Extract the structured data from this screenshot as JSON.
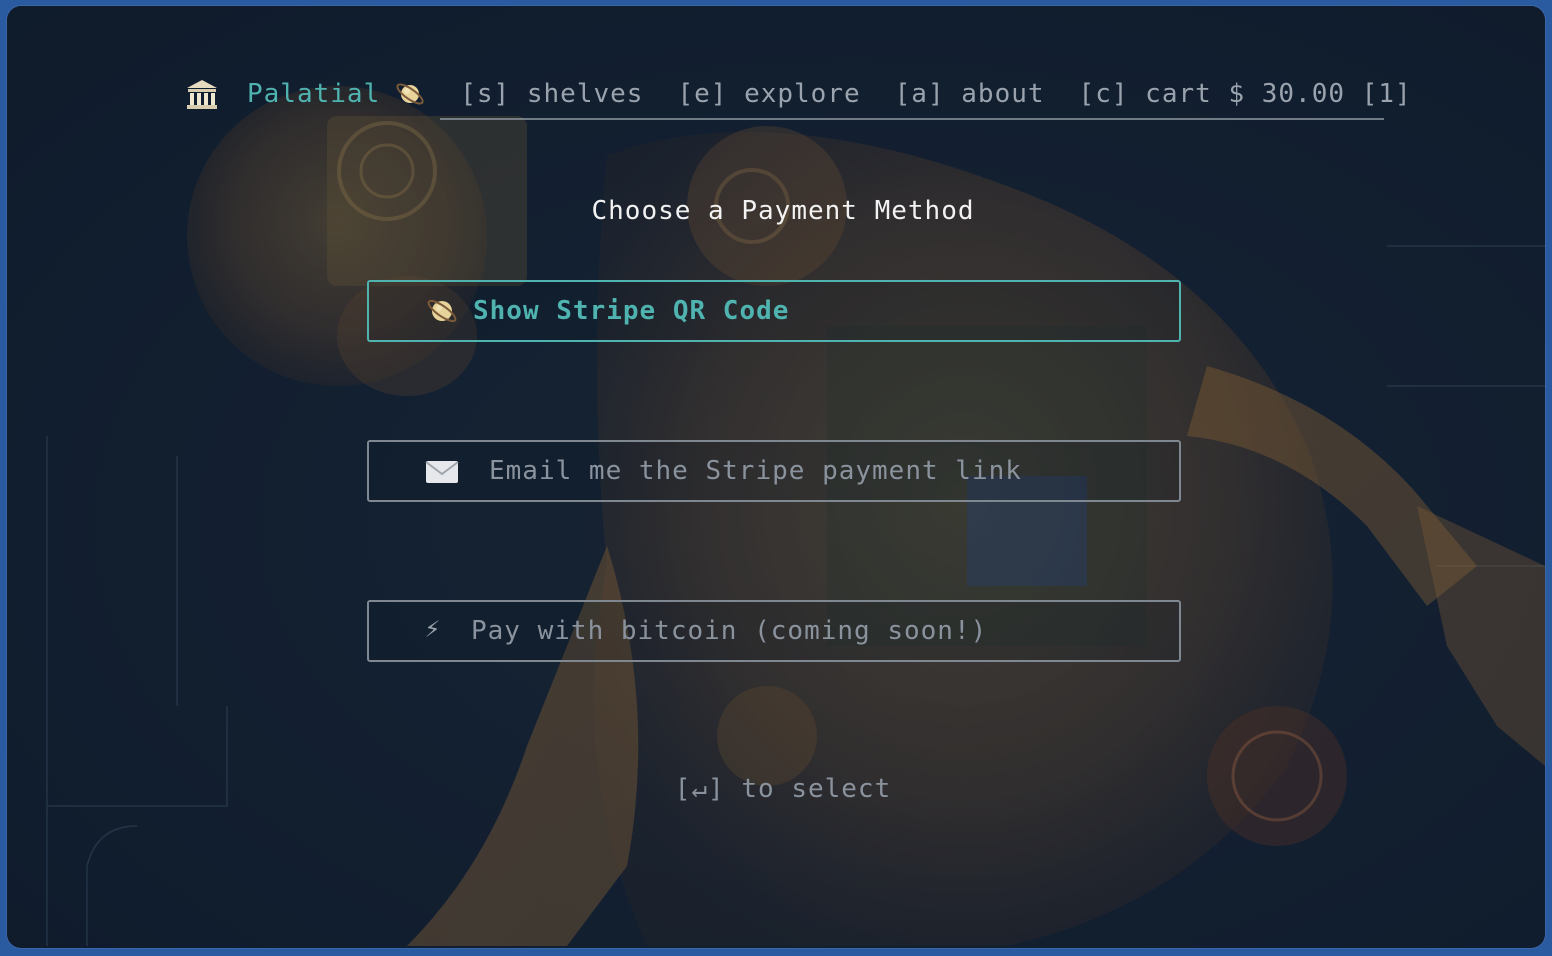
{
  "nav": {
    "brand": "Palatial",
    "logo_icon": "classical-building-icon",
    "brand_icon": "ringed-planet-icon",
    "items": [
      {
        "key": "[s]",
        "label": "shelves"
      },
      {
        "key": "[e]",
        "label": "explore"
      },
      {
        "key": "[a]",
        "label": "about"
      },
      {
        "key": "[c]",
        "label": "cart $ 30.00 [1]"
      }
    ]
  },
  "main": {
    "title": "Choose a Payment Method",
    "options": [
      {
        "label": "Show Stripe QR Code",
        "icon": "ringed-planet-icon",
        "selected": true
      },
      {
        "label": "Email me the Stripe payment link",
        "icon": "envelope-icon",
        "selected": false
      },
      {
        "label": "Pay with bitcoin (coming soon!)",
        "icon": "lightning-icon",
        "selected": false
      }
    ],
    "hint": "[↵] to select"
  },
  "colors": {
    "accent": "#4fb3b0",
    "muted": "#8a939d",
    "background": "#132031",
    "desktop": "#2a5aa0"
  }
}
